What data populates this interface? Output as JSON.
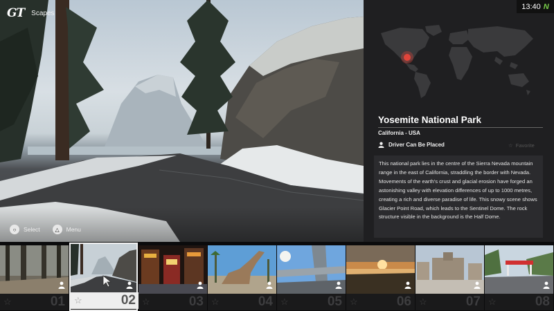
{
  "header": {
    "logo_text": "GT",
    "title": "Scapes",
    "clock": "13:40",
    "clock_badge": "N"
  },
  "hints": [
    {
      "glyph": "circle-button-icon",
      "label": "Select"
    },
    {
      "glyph": "triangle-button-icon",
      "label": "Menu"
    }
  ],
  "location": {
    "name": "Yosemite National Park",
    "region": "California - USA",
    "feature": "Driver Can Be Placed",
    "favorite": "Favorite",
    "description": "This national park lies in the centre of the Sierra Nevada mountain range in the east of California, straddling the border with Nevada. Movements of the earth's crust and glacial erosion have forged an astonishing valley with elevation differences of up to 1000 metres, creating a rich and diverse paradise of life. This snowy scene shows Glacier Point Road, which leads to the Sentinel Dome. The rock structure visible in the background is the Half Dome."
  },
  "map": {
    "marker_color": "#e0443a",
    "land_color": "#3a3a3c"
  },
  "thumbnails": [
    {
      "num": "01",
      "selected": false
    },
    {
      "num": "02",
      "selected": true
    },
    {
      "num": "03",
      "selected": false
    },
    {
      "num": "04",
      "selected": false
    },
    {
      "num": "05",
      "selected": false
    },
    {
      "num": "06",
      "selected": false
    },
    {
      "num": "07",
      "selected": false
    },
    {
      "num": "08",
      "selected": false
    }
  ]
}
